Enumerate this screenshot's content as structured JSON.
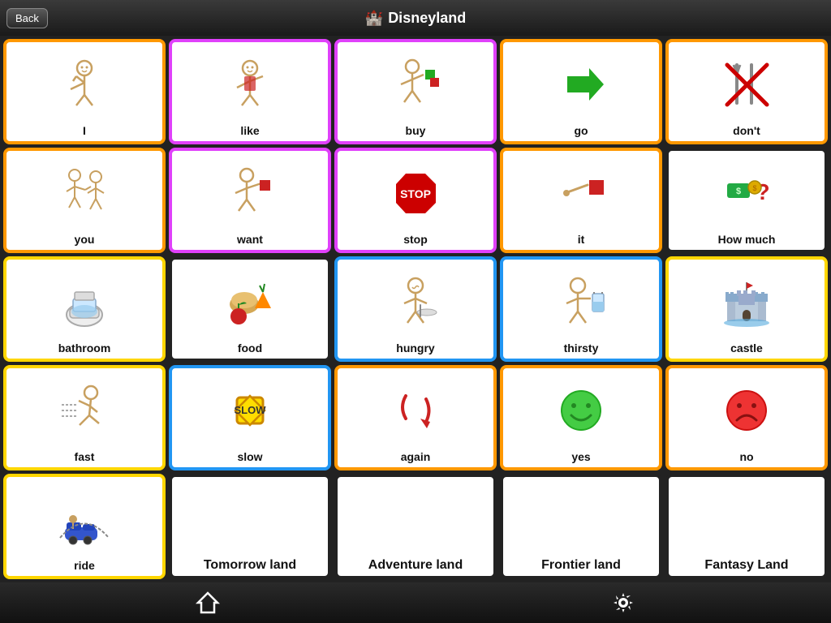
{
  "header": {
    "back_label": "Back",
    "title": "Disneyland"
  },
  "footer": {
    "home_label": "home",
    "settings_label": "settings"
  },
  "cells": [
    {
      "id": "i",
      "label": "I",
      "border": "orange"
    },
    {
      "id": "like",
      "label": "like",
      "border": "pink"
    },
    {
      "id": "buy",
      "label": "buy",
      "border": "pink"
    },
    {
      "id": "go",
      "label": "go",
      "border": "orange"
    },
    {
      "id": "dont",
      "label": "don't",
      "border": "orange"
    },
    {
      "id": "you",
      "label": "you",
      "border": "orange"
    },
    {
      "id": "want",
      "label": "want",
      "border": "pink"
    },
    {
      "id": "stop",
      "label": "stop",
      "border": "pink"
    },
    {
      "id": "it",
      "label": "it",
      "border": "orange"
    },
    {
      "id": "howmuch",
      "label": "How much",
      "border": "black"
    },
    {
      "id": "bathroom",
      "label": "bathroom",
      "border": "yellow"
    },
    {
      "id": "food",
      "label": "food",
      "border": "black"
    },
    {
      "id": "hungry",
      "label": "hungry",
      "border": "blue"
    },
    {
      "id": "thirsty",
      "label": "thirsty",
      "border": "blue"
    },
    {
      "id": "castle",
      "label": "castle",
      "border": "yellow"
    },
    {
      "id": "fast",
      "label": "fast",
      "border": "yellow"
    },
    {
      "id": "slow",
      "label": "slow",
      "border": "blue"
    },
    {
      "id": "again",
      "label": "again",
      "border": "orange"
    },
    {
      "id": "yes",
      "label": "yes",
      "border": "orange"
    },
    {
      "id": "no",
      "label": "no",
      "border": "orange"
    },
    {
      "id": "ride",
      "label": "ride",
      "border": "yellow"
    },
    {
      "id": "tomorrowland",
      "label": "Tomorrow land",
      "border": "black"
    },
    {
      "id": "adventureland",
      "label": "Adventure land",
      "border": "black"
    },
    {
      "id": "frontierland",
      "label": "Frontier land",
      "border": "black"
    },
    {
      "id": "fantasyland",
      "label": "Fantasy Land",
      "border": "black"
    }
  ]
}
